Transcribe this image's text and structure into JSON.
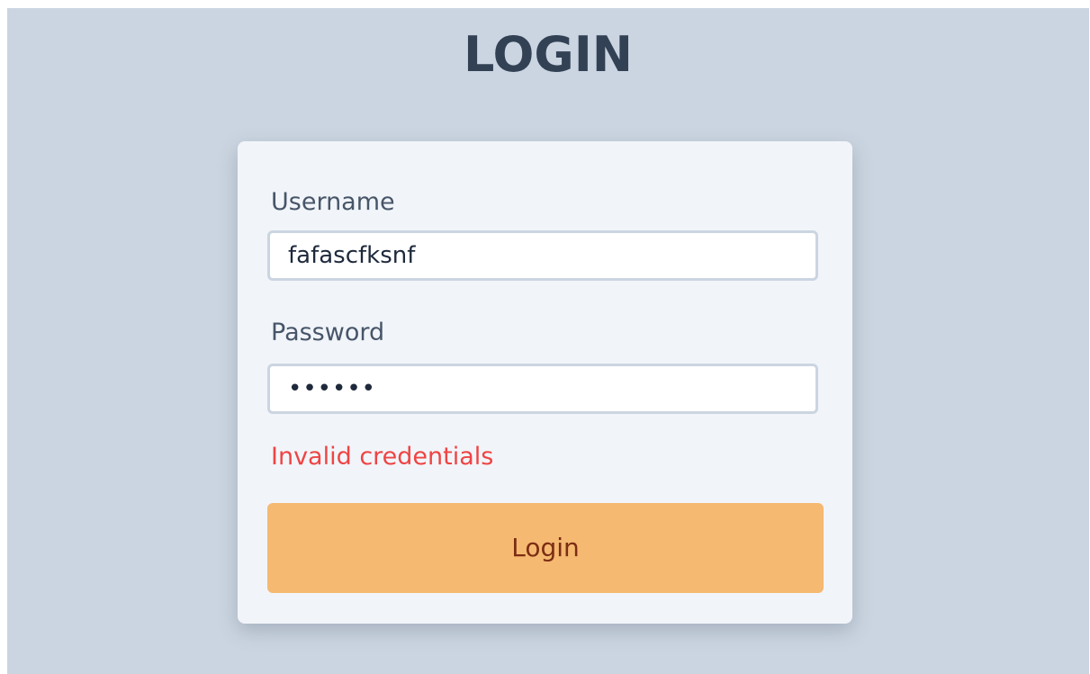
{
  "page": {
    "title": "LOGIN"
  },
  "form": {
    "username": {
      "label": "Username",
      "value": "fafascfksnf"
    },
    "password": {
      "label": "Password",
      "value": "••••••"
    },
    "error_message": "Invalid credentials",
    "submit_label": "Login"
  },
  "colors": {
    "background": "#cbd5e1",
    "card": "#f1f5f9",
    "title": "#334155",
    "error": "#ef4444",
    "button": "#f5b972",
    "button_text": "#7c2d12"
  }
}
